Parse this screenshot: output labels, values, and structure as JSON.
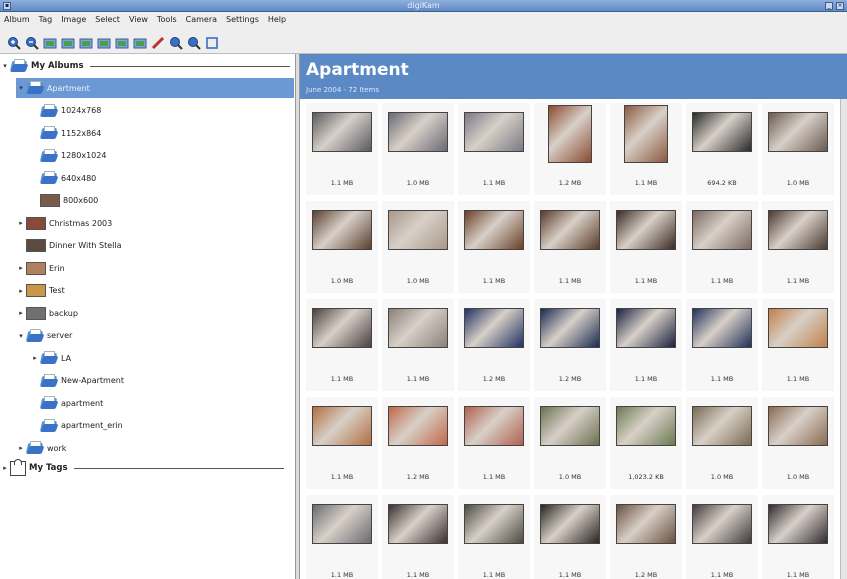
{
  "window": {
    "title": "digiKam"
  },
  "menubar": [
    "Album",
    "Tag",
    "Image",
    "Select",
    "View",
    "Tools",
    "Camera",
    "Settings",
    "Help"
  ],
  "toolbar": [
    "zoom-in-icon",
    "zoom-out-icon",
    "album-new-icon",
    "camera-import-icon",
    "camera-export-icon",
    "slideshow-icon",
    "image-rotate-icon",
    "image-properties-icon",
    "edit-pencil-icon",
    "search-icon",
    "advanced-search-icon",
    "fullscreen-icon"
  ],
  "sidebar": {
    "albums_root": "My Albums",
    "tags_root": "My Tags",
    "items": [
      {
        "label": "Apartment",
        "level": 1,
        "arrow": "▾",
        "icon": "folder",
        "selected": true
      },
      {
        "label": "1024x768",
        "level": 2,
        "arrow": "",
        "icon": "folder"
      },
      {
        "label": "1152x864",
        "level": 2,
        "arrow": "",
        "icon": "folder"
      },
      {
        "label": "1280x1024",
        "level": 2,
        "arrow": "",
        "icon": "folder"
      },
      {
        "label": "640x480",
        "level": 2,
        "arrow": "",
        "icon": "folder"
      },
      {
        "label": "800x600",
        "level": 2,
        "arrow": "",
        "icon": "thumb",
        "thumbColor": "#7a5a48"
      },
      {
        "label": "Christmas 2003",
        "level": 1,
        "arrow": "▸",
        "icon": "thumb",
        "thumbColor": "#8a4a3a"
      },
      {
        "label": "Dinner With Stella",
        "level": 1,
        "arrow": "",
        "icon": "thumb",
        "thumbColor": "#5a4a40"
      },
      {
        "label": "Erin",
        "level": 1,
        "arrow": "▸",
        "icon": "thumb",
        "thumbColor": "#b08060"
      },
      {
        "label": "Test",
        "level": 1,
        "arrow": "▸",
        "icon": "thumb",
        "thumbColor": "#c89848"
      },
      {
        "label": "backup",
        "level": 1,
        "arrow": "▸",
        "icon": "thumb",
        "thumbColor": "#707070"
      },
      {
        "label": "server",
        "level": 1,
        "arrow": "▾",
        "icon": "folder"
      },
      {
        "label": "LA",
        "level": 2,
        "arrow": "▸",
        "icon": "folder"
      },
      {
        "label": "New-Apartment",
        "level": 2,
        "arrow": "",
        "icon": "folder"
      },
      {
        "label": "apartment",
        "level": 2,
        "arrow": "",
        "icon": "folder"
      },
      {
        "label": "apartment_erin",
        "level": 2,
        "arrow": "",
        "icon": "folder"
      },
      {
        "label": "work",
        "level": 1,
        "arrow": "▸",
        "icon": "folder"
      }
    ]
  },
  "album": {
    "title": "Apartment",
    "subtitle": "June 2004 - 72 Items"
  },
  "photos": [
    {
      "size": "1.1 MB",
      "w": 60,
      "h": 40,
      "color": "#5a5a62"
    },
    {
      "size": "1.0 MB",
      "w": 60,
      "h": 40,
      "color": "#6a6a74"
    },
    {
      "size": "1.1 MB",
      "w": 60,
      "h": 40,
      "color": "#7a7a84"
    },
    {
      "size": "1.2 MB",
      "w": 44,
      "h": 58,
      "color": "#8a4a30"
    },
    {
      "size": "1.1 MB",
      "w": 44,
      "h": 58,
      "color": "#8a5a40"
    },
    {
      "size": "694.2 KB",
      "w": 60,
      "h": 40,
      "color": "#2a2a2a"
    },
    {
      "size": "1.0 MB",
      "w": 60,
      "h": 40,
      "color": "#6a5a50"
    },
    {
      "size": "1.0 MB",
      "w": 60,
      "h": 40,
      "color": "#5a4030"
    },
    {
      "size": "1.0 MB",
      "w": 60,
      "h": 40,
      "color": "#a89888"
    },
    {
      "size": "1.1 MB",
      "w": 60,
      "h": 40,
      "color": "#6a4028"
    },
    {
      "size": "1.1 MB",
      "w": 60,
      "h": 40,
      "color": "#5a3a28"
    },
    {
      "size": "1.1 MB",
      "w": 60,
      "h": 40,
      "color": "#3a2a22"
    },
    {
      "size": "1.1 MB",
      "w": 60,
      "h": 40,
      "color": "#7a6a60"
    },
    {
      "size": "1.1 MB",
      "w": 60,
      "h": 40,
      "color": "#4a3a30"
    },
    {
      "size": "1.1 MB",
      "w": 60,
      "h": 40,
      "color": "#4a4040"
    },
    {
      "size": "1.1 MB",
      "w": 60,
      "h": 40,
      "color": "#8a8078"
    },
    {
      "size": "1.2 MB",
      "w": 60,
      "h": 40,
      "color": "#203060"
    },
    {
      "size": "1.2 MB",
      "w": 60,
      "h": 40,
      "color": "#1a2a50"
    },
    {
      "size": "1.1 MB",
      "w": 60,
      "h": 40,
      "color": "#1a2240"
    },
    {
      "size": "1.1 MB",
      "w": 60,
      "h": 40,
      "color": "#22305a"
    },
    {
      "size": "1.1 MB",
      "w": 60,
      "h": 40,
      "color": "#c08048"
    },
    {
      "size": "1.1 MB",
      "w": 60,
      "h": 40,
      "color": "#b07040"
    },
    {
      "size": "1.2 MB",
      "w": 60,
      "h": 40,
      "color": "#c06848"
    },
    {
      "size": "1.1 MB",
      "w": 60,
      "h": 40,
      "color": "#b06050"
    },
    {
      "size": "1.0 MB",
      "w": 60,
      "h": 40,
      "color": "#6a7050"
    },
    {
      "size": "1,023.2 KB",
      "w": 60,
      "h": 40,
      "color": "#6a7a50"
    },
    {
      "size": "1.0 MB",
      "w": 60,
      "h": 40,
      "color": "#7a6a50"
    },
    {
      "size": "1.0 MB",
      "w": 60,
      "h": 40,
      "color": "#8a6a50"
    },
    {
      "size": "1.1 MB",
      "w": 60,
      "h": 40,
      "color": "#6a6a70"
    },
    {
      "size": "1.1 MB",
      "w": 60,
      "h": 40,
      "color": "#3a3030"
    },
    {
      "size": "1.1 MB",
      "w": 60,
      "h": 40,
      "color": "#4a4a40"
    },
    {
      "size": "1.1 MB",
      "w": 60,
      "h": 40,
      "color": "#2a2420"
    },
    {
      "size": "1.2 MB",
      "w": 60,
      "h": 40,
      "color": "#6a5040"
    },
    {
      "size": "1.1 MB",
      "w": 60,
      "h": 40,
      "color": "#403a3a"
    },
    {
      "size": "1.1 MB",
      "w": 60,
      "h": 40,
      "color": "#302a30"
    }
  ]
}
